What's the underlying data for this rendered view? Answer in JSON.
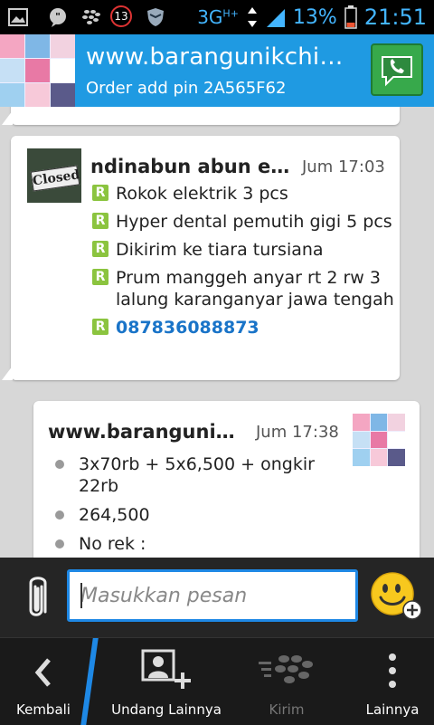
{
  "status_bar": {
    "notif_badge": "13",
    "network": "3G",
    "network_sup": "H+",
    "battery": "13%",
    "time": "21:51"
  },
  "header": {
    "title": "www.barangunikchin...",
    "subtitle": "Order add pin 2A565F62"
  },
  "messages": [
    {
      "sender": "ndinabun abun en...",
      "time": "Jum 17:03",
      "avatar_text": "Closed",
      "lines": [
        "Rokok elektrik 3 pcs",
        "Hyper dental pemutih gigi 5 pcs",
        "Dikirim ke tiara tursiana",
        "Prum manggeh anyar rt 2 rw 3 lalung karanganyar jawa tengah",
        "087836088873"
      ]
    },
    {
      "sender": "www.barangunik...",
      "time": "Jum 17:38",
      "lines": [
        "3x70rb + 5x6,500 + ongkir 22rb",
        "264,500",
        "No rek :"
      ]
    }
  ],
  "composer": {
    "placeholder": "Masukkan pesan"
  },
  "nav": {
    "back": "Kembali",
    "invite": "Undang Lainnya",
    "send": "Kirim",
    "more": "Lainnya"
  },
  "colors": {
    "accent": "#1f9ae2",
    "link": "#1a74c8",
    "bbm_r": "#8bc43f"
  }
}
